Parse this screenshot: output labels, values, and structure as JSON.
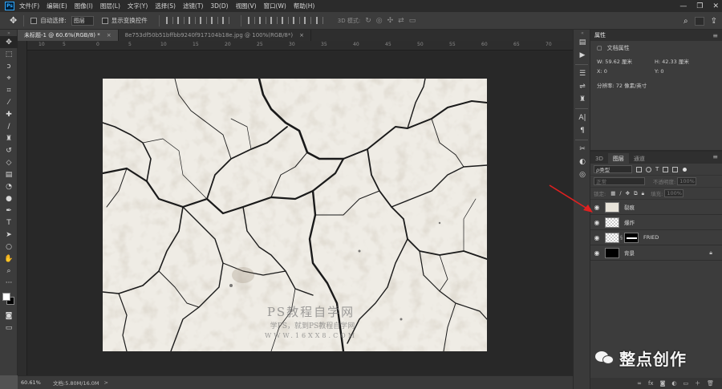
{
  "menubar": {
    "logo": "Ps",
    "items": [
      "文件(F)",
      "编辑(E)",
      "图像(I)",
      "图层(L)",
      "文字(Y)",
      "选择(S)",
      "滤镜(T)",
      "3D(D)",
      "视图(V)",
      "窗口(W)",
      "帮助(H)"
    ],
    "window_controls": [
      "—",
      "❐",
      "✕"
    ]
  },
  "options": {
    "auto_select_label": "自动选择:",
    "auto_select_value": "图层",
    "show_transform_label": "显示变换控件",
    "mode_3d_label": "3D 模式:"
  },
  "tabs": [
    {
      "label": "未标题-1 @ 60.6%(RGB/8) *",
      "close": "×",
      "active": true
    },
    {
      "label": "8e753df50b51bffbb9240f917104b18e.jpg @ 100%(RGB/8*)",
      "close": "×",
      "active": false
    }
  ],
  "ruler": {
    "ticks": [
      "10",
      "5",
      "0",
      "5",
      "10",
      "15",
      "20",
      "25",
      "30",
      "35",
      "40",
      "45",
      "50",
      "55",
      "60",
      "65",
      "70"
    ]
  },
  "canvas": {
    "watermark_line1": "PS教程自学网",
    "watermark_line2": "学PS，就到PS教程自学网",
    "watermark_line3": "WWW.16XX8.COM"
  },
  "status": {
    "zoom": "60.61%",
    "doc_info": "文档:5.80M/16.0M",
    "arrow": ">"
  },
  "properties": {
    "title": "属性",
    "subtitle": "文档属性",
    "w_label": "W: 59.62 厘米",
    "h_label": "H: 42.33 厘米",
    "x_label": "X: 0",
    "y_label": "Y: 0",
    "resolution": "分辨率: 72 像素/英寸"
  },
  "layers_panel": {
    "tabs": [
      "3D",
      "图层",
      "通道"
    ],
    "active_tab": "图层",
    "filter_kind": "ρ类型",
    "blend_mode": "正常",
    "opacity_label": "不透明度:",
    "opacity_value": "100%",
    "lock_label": "锁定:",
    "fill_label": "填充:",
    "fill_value": "100%",
    "layers": [
      {
        "name": "裂痕",
        "thumb": "texture",
        "mask": false,
        "locked": false
      },
      {
        "name": "爆炸",
        "thumb": "transparent",
        "mask": false,
        "locked": false
      },
      {
        "name": "FRIED",
        "thumb": "transparent",
        "mask": true,
        "locked": false
      },
      {
        "name": "背景",
        "thumb": "black",
        "mask": false,
        "locked": true
      }
    ]
  },
  "brand": {
    "text": "整点创作"
  },
  "colors": {
    "accent_red": "#e02020",
    "foreground": "#ffffff",
    "background": "#000000"
  }
}
